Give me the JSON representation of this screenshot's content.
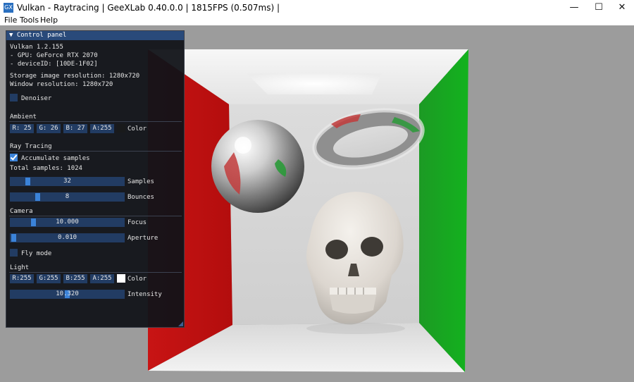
{
  "window": {
    "app_icon": "GX",
    "title": "Vulkan - Raytracing | GeeXLab 0.40.0.0 | 1815FPS (0.507ms) |",
    "minimize": "—",
    "maximize": "☐",
    "close": "✕"
  },
  "menu": [
    "File",
    "Tools",
    "Help"
  ],
  "panel": {
    "header": "▼ Control panel",
    "info": [
      "Vulkan 1.2.155",
      "- GPU: GeForce RTX 2070",
      "- deviceID: [10DE-1F02]"
    ],
    "storage_res": "Storage image resolution: 1280x720",
    "window_res": "Window resolution: 1280x720",
    "denoiser": {
      "label": "Denoiser",
      "checked": false
    },
    "ambient": {
      "section": "Ambient",
      "r": "R: 25",
      "g": "G: 26",
      "b": "B: 27",
      "a": "A:255",
      "color_label": "Color",
      "swatch": "#191a1b"
    },
    "raytracing": {
      "section": "Ray Tracing",
      "accumulate": {
        "label": "Accumulate samples",
        "checked": true
      },
      "total": "Total samples: 1024",
      "samples": {
        "value": "32",
        "label": "Samples",
        "fraction": 0.14
      },
      "bounces": {
        "value": "8",
        "label": "Bounces",
        "fraction": 0.23
      }
    },
    "camera": {
      "section": "Camera",
      "focus": {
        "value": "10.000",
        "label": "Focus",
        "fraction": 0.19
      },
      "aperture": {
        "value": "0.010",
        "label": "Aperture",
        "fraction": 0.01
      },
      "fly": {
        "label": "Fly mode",
        "checked": false
      }
    },
    "light": {
      "section": "Light",
      "r": "R:255",
      "g": "G:255",
      "b": "B:255",
      "a": "A:255",
      "color_label": "Color",
      "swatch": "#ffffff",
      "intensity": {
        "value": "10.320",
        "label": "Intensity",
        "fraction": 0.5
      }
    }
  }
}
